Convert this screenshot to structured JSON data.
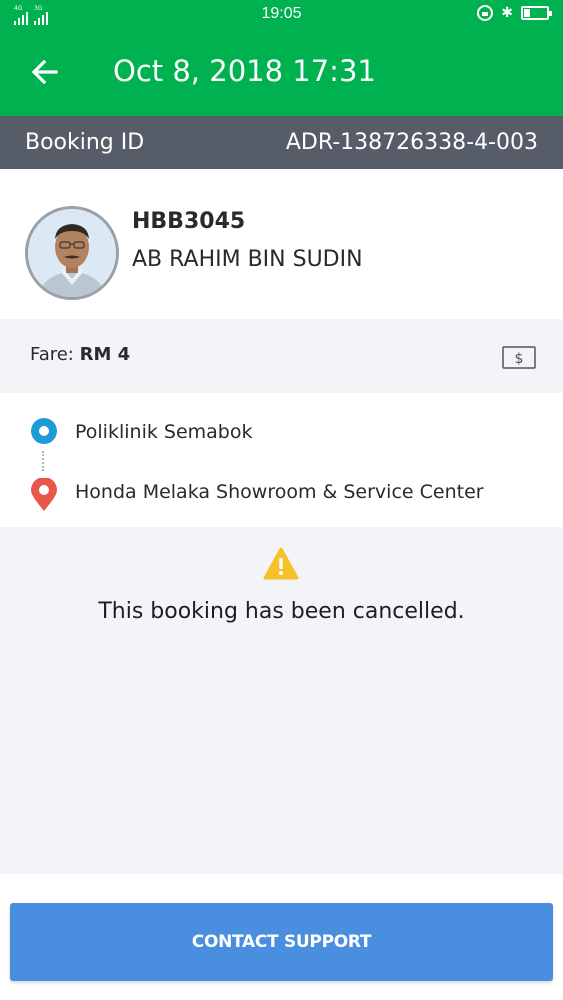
{
  "status_bar": {
    "network_1": "4G",
    "network_2": "3G",
    "time": "19:05"
  },
  "header": {
    "title": "Oct 8, 2018 17:31",
    "back_icon": "arrow-left-icon"
  },
  "booking": {
    "id_label": "Booking ID",
    "id_value": "ADR-138726338-4-003"
  },
  "driver": {
    "plate": "HBB3045",
    "name": "AB RAHIM BIN SUDIN"
  },
  "fare": {
    "label": "Fare:",
    "amount": "RM 4",
    "payment_icon": "cash-icon"
  },
  "route": {
    "pickup": "Poliklinik Semabok",
    "dropoff": "Honda Melaka Showroom & Service Center"
  },
  "status": {
    "icon": "warning-icon",
    "message": "This booking has been cancelled."
  },
  "actions": {
    "contact_support": "CONTACT SUPPORT"
  },
  "colors": {
    "brand_green": "#00b14f",
    "booking_bar": "#565d68",
    "pickup_blue": "#1e9bd7",
    "dropoff_red": "#e8584a",
    "warning_yellow": "#f6c22a",
    "button_blue": "#4a8fdf"
  }
}
